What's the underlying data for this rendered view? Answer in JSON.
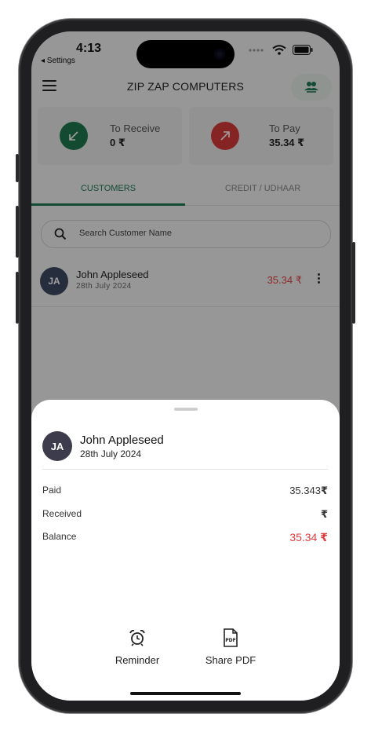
{
  "status_bar": {
    "time": "4:13",
    "back_label": "◂ Settings"
  },
  "header": {
    "title": "ZIP ZAP COMPUTERS"
  },
  "summary": {
    "to_receive": {
      "label": "To Receive",
      "value": "0 ₹",
      "color": "#1e7a4d"
    },
    "to_pay": {
      "label": "To Pay",
      "value": "35.34 ₹",
      "color": "#d93a3a"
    }
  },
  "tabs": [
    {
      "label": "CUSTOMERS",
      "active": true
    },
    {
      "label": "CREDIT / UDHAAR",
      "active": false
    }
  ],
  "search": {
    "placeholder": "Search Customer Name"
  },
  "customers": [
    {
      "initials": "JA",
      "name": "John Appleseed",
      "date": "28th July 2024",
      "amount": "35.34 ₹"
    }
  ],
  "sheet": {
    "initials": "JA",
    "name": "John Appleseed",
    "date": "28th July 2024",
    "rows": [
      {
        "label": "Paid",
        "value": "35.343",
        "currency": "₹"
      },
      {
        "label": "Received",
        "value": "",
        "currency": "₹"
      },
      {
        "label": "Balance",
        "value": "35.34",
        "currency": "₹"
      }
    ],
    "actions": [
      {
        "label": "Reminder",
        "icon": "alarm-clock-icon"
      },
      {
        "label": "Share PDF",
        "icon": "pdf-file-icon"
      }
    ]
  },
  "colors": {
    "accent": "#1f7a54",
    "negative": "#e04545",
    "avatar": "#3e4b63"
  }
}
